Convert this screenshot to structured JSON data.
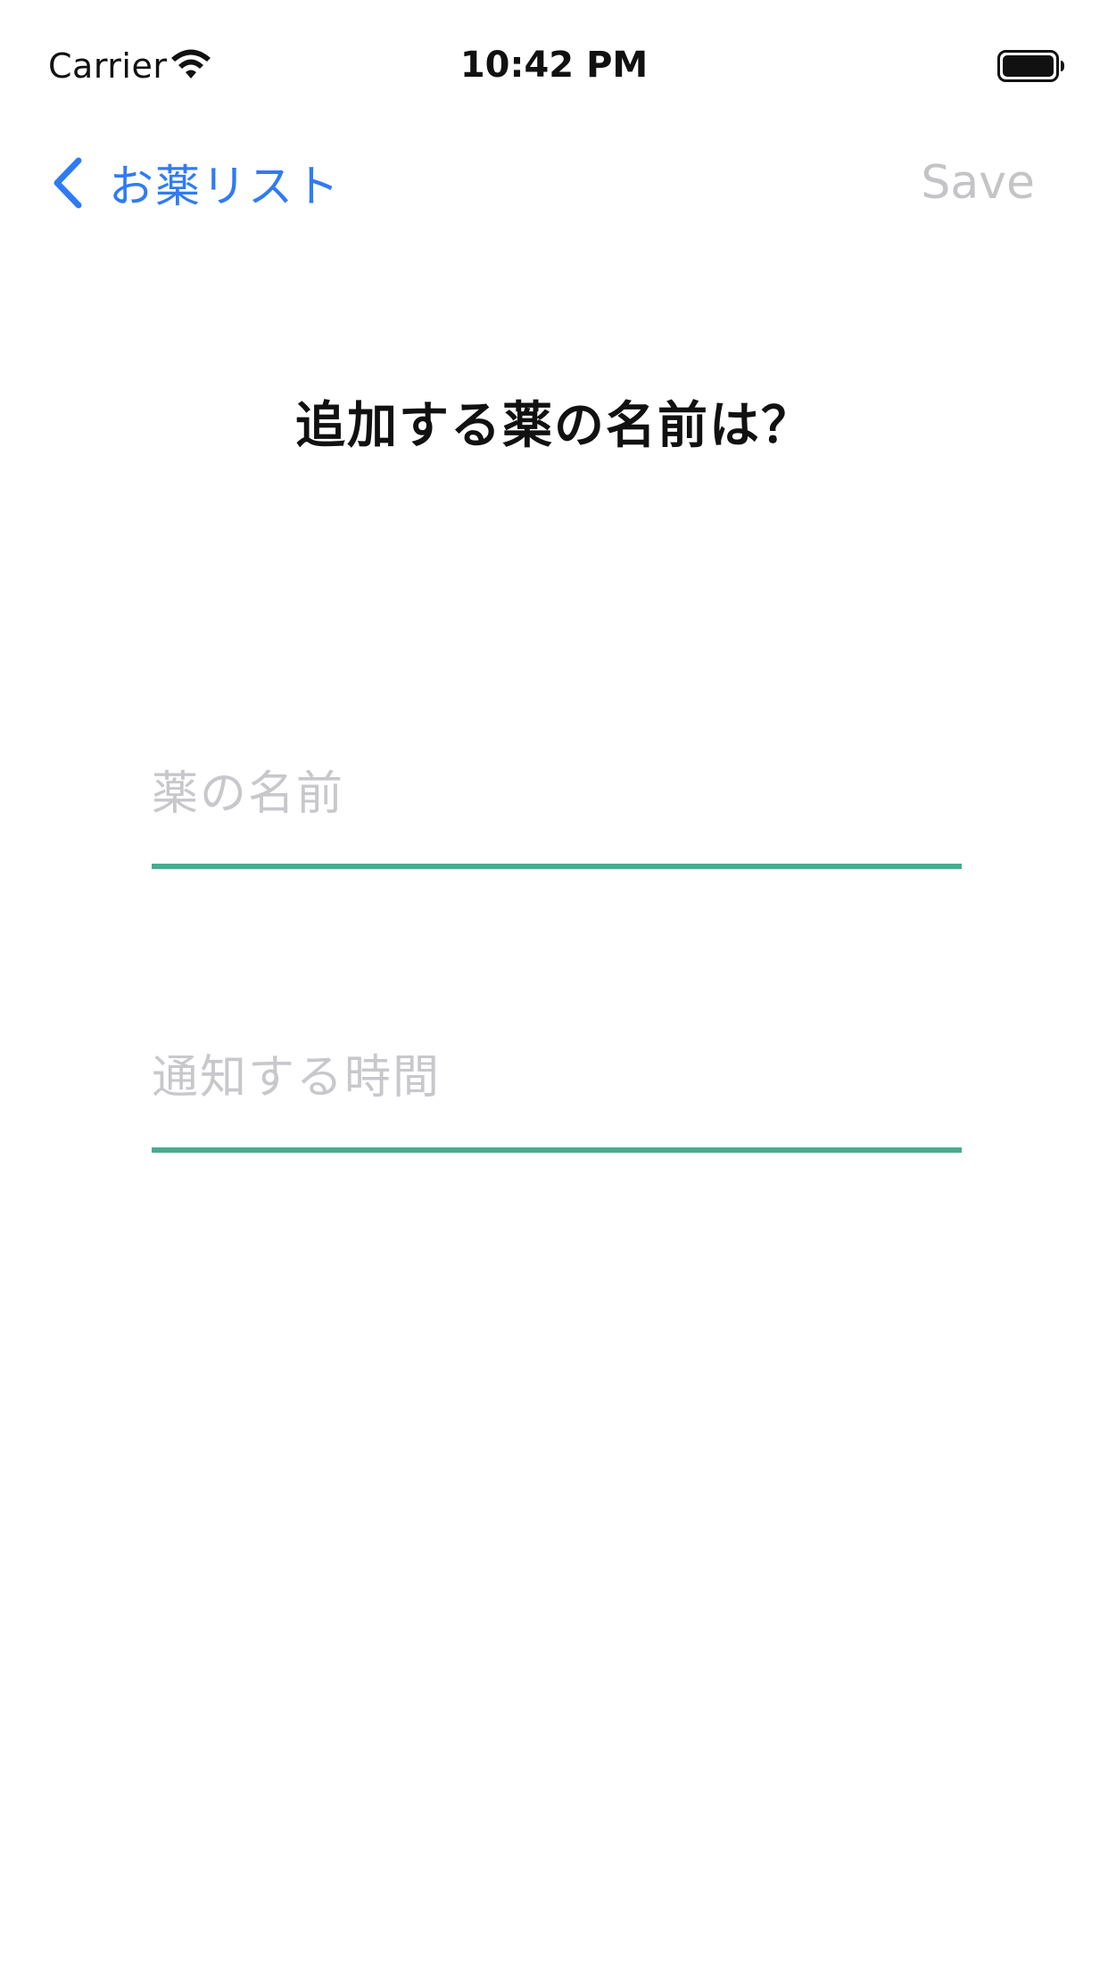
{
  "status_bar": {
    "carrier": "Carrier",
    "time": "10:42 PM",
    "wifi_icon": "wifi-icon",
    "battery_icon": "battery-icon"
  },
  "nav": {
    "back_label": "お薬リスト",
    "back_icon": "chevron-left-icon",
    "save_label": "Save"
  },
  "main": {
    "title": "追加する薬の名前は？",
    "name_field": {
      "value": "",
      "placeholder": "薬の名前"
    },
    "time_field": {
      "value": "",
      "placeholder": "通知する時間"
    }
  },
  "colors": {
    "accent": "#2f7bf5",
    "underline": "#4aab8f",
    "disabled": "#c4c4c6",
    "placeholder": "#c8c8cc"
  }
}
